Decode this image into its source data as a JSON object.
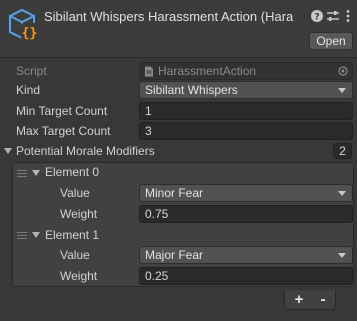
{
  "header": {
    "title": "Sibilant Whispers Harassment Action (Hara",
    "open_label": "Open",
    "icons": [
      "scriptable-object-icon",
      "help-icon",
      "settings-sliders-icon",
      "more-menu-icon"
    ]
  },
  "script": {
    "label": "Script",
    "value": "HarassmentAction",
    "icon": "script-file-icon"
  },
  "kind": {
    "label": "Kind",
    "value": "Sibilant Whispers"
  },
  "min_target": {
    "label": "Min Target Count",
    "value": "1"
  },
  "max_target": {
    "label": "Max Target Count",
    "value": "3"
  },
  "modifiers": {
    "label": "Potential Morale Modifiers",
    "count": "2",
    "elements": [
      {
        "label": "Element 0",
        "value_label": "Value",
        "value": "Minor Fear",
        "weight_label": "Weight",
        "weight": "0.75"
      },
      {
        "label": "Element 1",
        "value_label": "Value",
        "value": "Major Fear",
        "weight_label": "Weight",
        "weight": "0.25"
      }
    ],
    "add_label": "+",
    "remove_label": "-"
  },
  "colors": {
    "background": "#383838",
    "field": "#2a2a2a",
    "dropdown": "#515151",
    "icon_accent": "#ff9a1f",
    "icon_blue": "#5aa0e6"
  }
}
